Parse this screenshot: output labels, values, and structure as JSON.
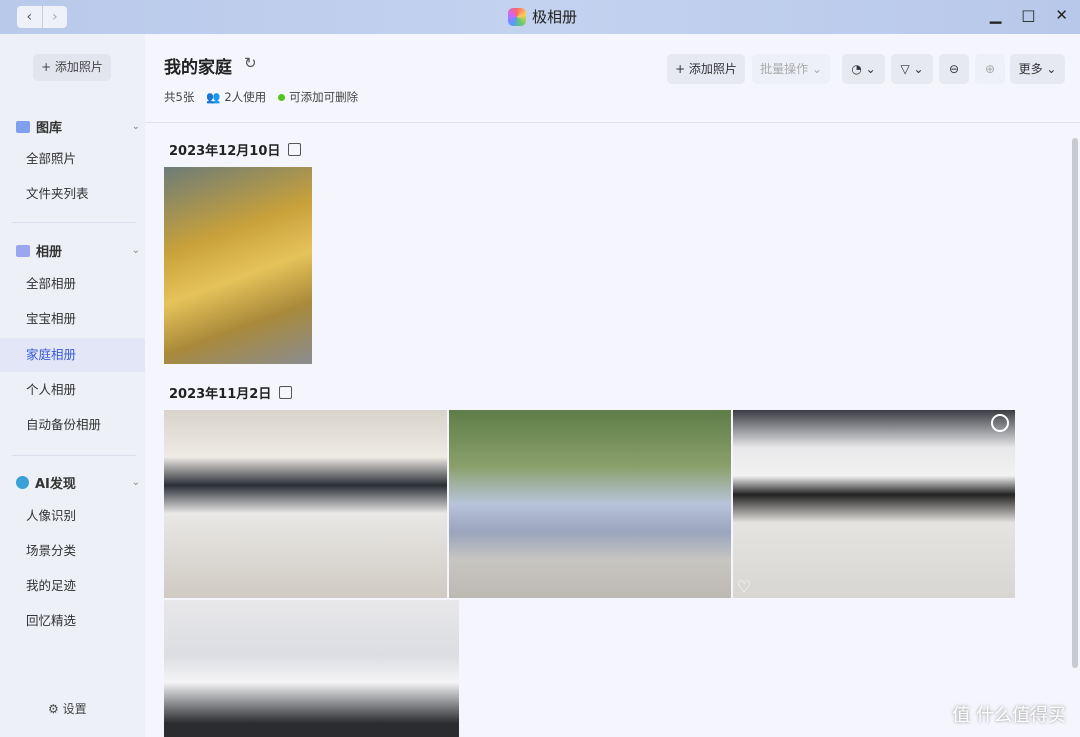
{
  "app": {
    "title": "极相册"
  },
  "sidebar": {
    "add_label": "+ 添加照片",
    "library": {
      "label": "图库",
      "items": [
        "全部照片",
        "文件夹列表"
      ]
    },
    "albums": {
      "label": "相册",
      "items": [
        "全部相册",
        "宝宝相册",
        "家庭相册",
        "个人相册",
        "自动备份相册"
      ],
      "active": "家庭相册"
    },
    "ai": {
      "label": "AI发现",
      "items": [
        "人像识别",
        "场景分类",
        "我的足迹",
        "回忆精选"
      ]
    },
    "settings_label": "设置"
  },
  "main": {
    "title": "我的家庭",
    "count": "共5张",
    "users": "2人使用",
    "permission": "可添加可删除",
    "toolbar": {
      "add": "+ 添加照片",
      "batch": "批量操作 ⌄",
      "sort": "⌄",
      "filter": "⌄",
      "more": "更多 ⌄"
    },
    "groups": [
      {
        "date": "2023年12月10日"
      },
      {
        "date": "2023年11月2日"
      }
    ]
  },
  "watermark": "值 什么值得买",
  "colors": {
    "accent": "#3a5bd9",
    "status": "#52c41a"
  }
}
